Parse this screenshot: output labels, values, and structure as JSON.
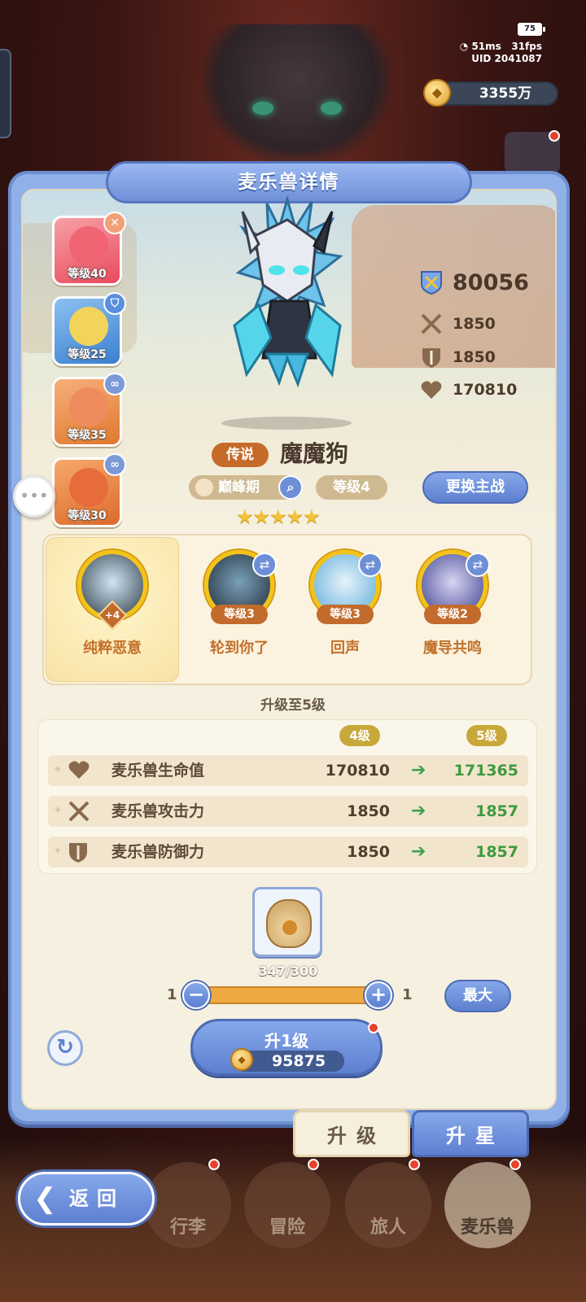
{
  "status": {
    "battery": "75",
    "ping": "51ms",
    "fps": "31fps",
    "uid": "UID 2041087"
  },
  "currency": {
    "gold": "3355万"
  },
  "panel": {
    "title": "麦乐兽详情"
  },
  "team_cards": [
    {
      "level": "等级40",
      "badge": "close",
      "color": "#e8485a"
    },
    {
      "level": "等级25",
      "badge": "shield",
      "color": "#4c8fd6"
    },
    {
      "level": "等级35",
      "badge": "link",
      "color": "#e9793a"
    },
    {
      "level": "等级30",
      "badge": "link",
      "color": "#e36a32"
    }
  ],
  "stats": {
    "power": "80056",
    "attack": "1850",
    "defense": "1850",
    "hp": "170810"
  },
  "monster": {
    "rarity": "传说",
    "name": "魔魔狗",
    "stage": "巅峰期",
    "level": "等级4",
    "stars": "★★★★★",
    "change_label": "更换主战"
  },
  "skills": [
    {
      "name": "纯粹恶意",
      "level": "+4",
      "selected": true
    },
    {
      "name": "轮到你了",
      "level": "等级3"
    },
    {
      "name": "回声",
      "level": "等级3"
    },
    {
      "name": "魔导共鸣",
      "level": "等级2"
    }
  ],
  "upgrade": {
    "title": "升级至5级",
    "from_level": "4级",
    "to_level": "5级",
    "rows": [
      {
        "label": "麦乐兽生命值",
        "current": "170810",
        "next": "171365",
        "icon": "heart-icon"
      },
      {
        "label": "麦乐兽攻击力",
        "current": "1850",
        "next": "1857",
        "icon": "swords-icon"
      },
      {
        "label": "麦乐兽防御力",
        "current": "1850",
        "next": "1857",
        "icon": "shield-icon"
      }
    ],
    "item_count": "347/300",
    "min_value": "1",
    "max_value": "1",
    "max_label": "最大",
    "button_label": "升1级",
    "cost": "95875"
  },
  "tabs": {
    "upgrade": "升级",
    "star": "升星"
  },
  "bottom_nav": {
    "back": "返回",
    "items": [
      "行李",
      "冒险",
      "旅人",
      "麦乐兽"
    ]
  },
  "colors": {
    "accent": "#6f90d8",
    "panel_bg": "#f6f0e0",
    "rarity": "#c66a2a"
  }
}
